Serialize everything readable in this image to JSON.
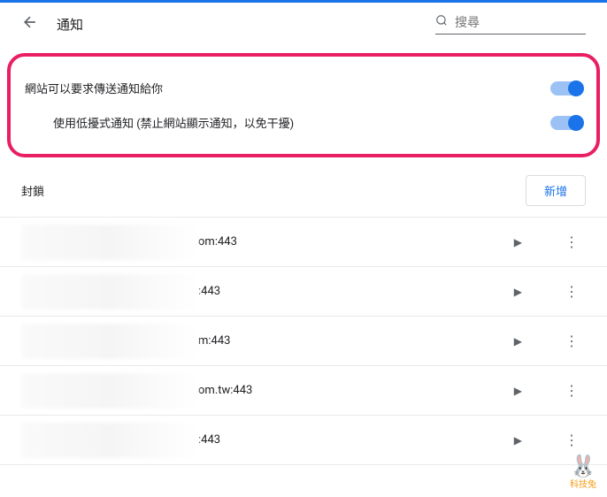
{
  "header": {
    "title": "通知",
    "search_placeholder": "搜尋"
  },
  "settings": {
    "main_toggle_label": "網站可以要求傳送通知給你",
    "sub_toggle_label": "使用低擾式通知 (禁止網站顯示通知，以免干擾)"
  },
  "blocked_section": {
    "title": "封鎖",
    "add_button": "新增"
  },
  "sites": [
    {
      "suffix": "om:443"
    },
    {
      "suffix": ":443"
    },
    {
      "suffix": "m:443"
    },
    {
      "suffix": "om.tw:443"
    },
    {
      "suffix": ":443"
    }
  ],
  "corner_logo": "科技兔"
}
